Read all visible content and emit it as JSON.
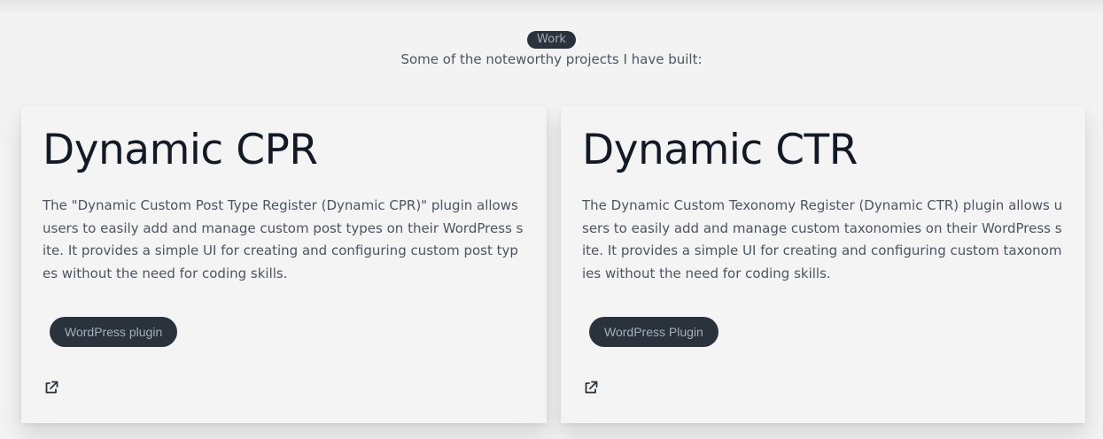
{
  "section": {
    "badge": "Work",
    "subtitle": "Some of the noteworthy projects I have built:"
  },
  "projects": [
    {
      "title": "Dynamic CPR",
      "description": "The \"Dynamic Custom Post Type Register (Dynamic CPR)\" plugin allows users to easily add and manage custom post types on their WordPress site. It provides a simple UI for creating and configuring custom post types without the need for coding skills.",
      "tag": "WordPress plugin",
      "link_icon": "external-link-icon"
    },
    {
      "title": "Dynamic CTR",
      "description": "The Dynamic Custom Texonomy Register (Dynamic CTR) plugin allows users to easily add and manage custom taxonomies on their WordPress site. It provides a simple UI for creating and configuring custom taxonomies without the need for coding skills.",
      "tag": "WordPress Plugin",
      "link_icon": "external-link-icon"
    }
  ],
  "colors": {
    "background": "#f3f3f3",
    "card": "#f4f4f4",
    "badge_bg": "#2a323c",
    "badge_text": "#a6adbb",
    "title": "#131a26",
    "body_text": "#4b5563"
  }
}
